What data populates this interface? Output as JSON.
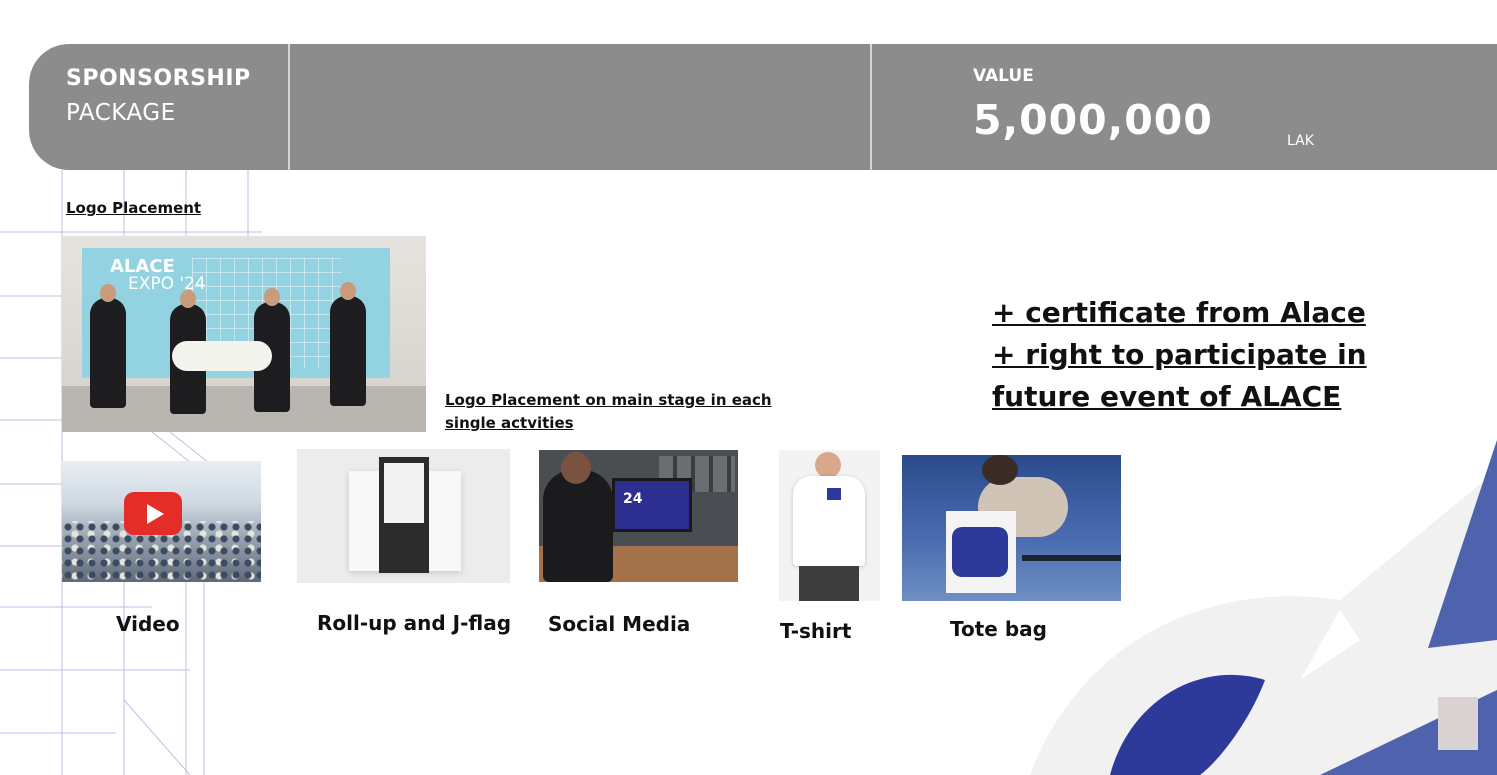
{
  "header": {
    "title_bold": "SPONSORSHIP",
    "title_regular": "PACKAGE",
    "value_label": "VALUE",
    "value_amount": "5,000,000",
    "currency": "LAK"
  },
  "logo_placement": {
    "label": "Logo Placement",
    "stage_caption": "Logo Placement on main stage in each single actvities ",
    "stage_screen_logo_line1": "ALACE",
    "stage_screen_logo_line2": "EXPO '24"
  },
  "benefits": [
    "+ certificate from Alace ",
    "+ right to participate in",
    "future event of ALACE "
  ],
  "items": [
    {
      "label": "Video",
      "icon": "play-icon"
    },
    {
      "label": "Roll-up and J-flag"
    },
    {
      "label": "Social Media"
    },
    {
      "label": "T-shirt"
    },
    {
      "label": "Tote bag"
    }
  ],
  "colors": {
    "header_bg": "#8c8c8c",
    "accent_blue": "#2d3a9a",
    "accent_blue_light": "#4f62ad",
    "line_purple": "#b9a6d8"
  }
}
